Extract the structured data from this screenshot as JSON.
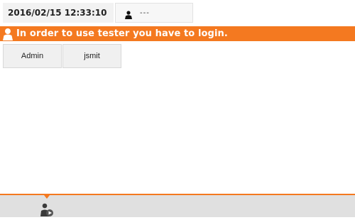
{
  "header": {
    "datetime": "2016/02/15 12:33:10",
    "current_user": "---"
  },
  "banner": {
    "message": "In order to use tester you have to login."
  },
  "users": [
    {
      "label": "Admin"
    },
    {
      "label": "jsmit"
    }
  ],
  "colors": {
    "accent": "#f47920",
    "bottom_bar": "#e0e0e0"
  },
  "icons": {
    "header_user": "user-icon",
    "banner_user": "user-icon",
    "bottom_action": "user-play-icon"
  }
}
